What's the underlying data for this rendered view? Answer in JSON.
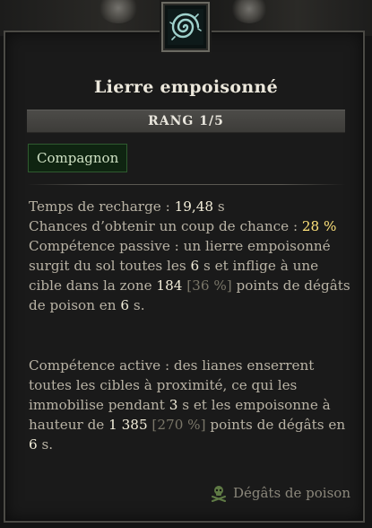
{
  "skill": {
    "icon": "thorn-spiral-icon",
    "title": "Lierre empoisonné",
    "rank_label": "RANG 1/5",
    "tag": "Compagnon"
  },
  "stats": {
    "cooldown_label": "Temps de recharge : ",
    "cooldown_value": "19,48",
    "cooldown_unit": " s",
    "lucky_label": "Chances d’obtenir un coup de chance : ",
    "lucky_value": "28 %"
  },
  "passive": {
    "p1": "Compétence passive : un lierre empoisonné surgit du sol toutes les ",
    "interval": "6",
    "p2": " s et inflige à une cible dans la zone ",
    "damage": "184",
    "damage_pct": " [36 %]",
    "p3": " points de dégâts de poison en ",
    "duration": "6",
    "p4": " s."
  },
  "active": {
    "p1": "Compétence active : des lianes enserrent toutes les cibles à proximité, ce qui les immobilise pendant ",
    "root_duration": "3",
    "p2": " s et les empoisonne à hauteur de ",
    "damage": "1 385",
    "damage_pct": " [270 %]",
    "p3": " points de dégâts en ",
    "duration": "6",
    "p4": " s."
  },
  "footer": {
    "icon": "skull-crossbones-icon",
    "damage_type": "Dégâts de poison"
  },
  "colors": {
    "value_white": "#f2edd9",
    "value_yellow": "#fde17a",
    "tag_bg": "#0f2411",
    "text": "#b9b3a5"
  }
}
